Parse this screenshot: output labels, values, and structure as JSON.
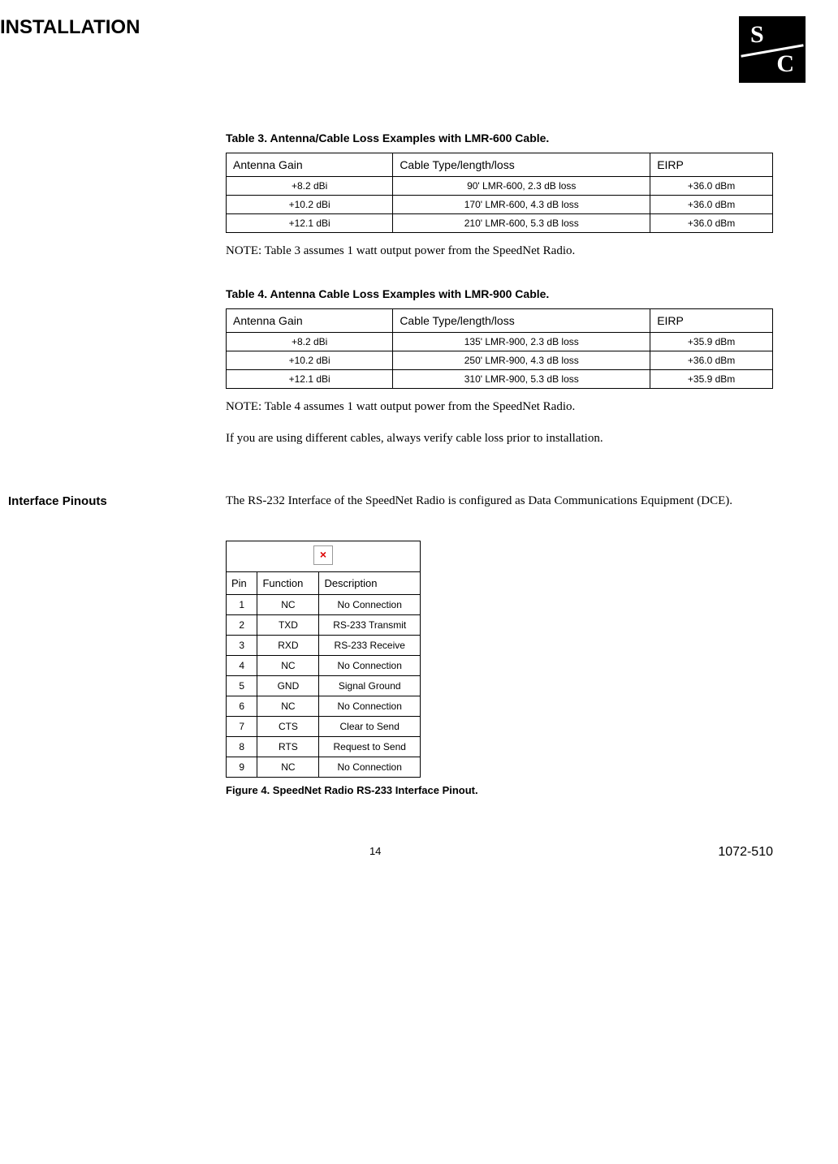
{
  "header": {
    "title": "INSTALLATION"
  },
  "table3": {
    "caption": "Table 3. Antenna/Cable Loss Examples with LMR-600 Cable.",
    "headers": [
      "Antenna Gain",
      "Cable Type/length/loss",
      "EIRP"
    ],
    "rows": [
      [
        "+8.2 dBi",
        "90' LMR-600, 2.3 dB loss",
        "+36.0 dBm"
      ],
      [
        "+10.2 dBi",
        "170' LMR-600, 4.3 dB loss",
        "+36.0 dBm"
      ],
      [
        "+12.1 dBi",
        "210' LMR-600, 5.3 dB loss",
        "+36.0 dBm"
      ]
    ],
    "note": "NOTE: Table 3 assumes 1 watt output power from the SpeedNet Radio."
  },
  "table4": {
    "caption": "Table 4. Antenna Cable Loss Examples with LMR-900 Cable.",
    "headers": [
      "Antenna Gain",
      "Cable Type/length/loss",
      "EIRP"
    ],
    "rows": [
      [
        "+8.2 dBi",
        "135' LMR-900, 2.3 dB loss",
        "+35.9 dBm"
      ],
      [
        "+10.2 dBi",
        "250' LMR-900, 4.3 dB loss",
        "+36.0 dBm"
      ],
      [
        "+12.1 dBi",
        "310' LMR-900, 5.3 dB loss",
        "+35.9 dBm"
      ]
    ],
    "note": "NOTE: Table 4 assumes 1 watt output power from the SpeedNet Radio.",
    "body": "If you are using different cables, always verify cable loss prior to installation."
  },
  "section_pinouts": {
    "label": "Interface Pinouts",
    "intro": "The RS-232 Interface of the SpeedNet Radio is configured as Data Communications Equipment (DCE).",
    "headers": [
      "Pin",
      "Function",
      "Description"
    ],
    "rows": [
      [
        "1",
        "NC",
        "No Connection"
      ],
      [
        "2",
        "TXD",
        "RS-233 Transmit"
      ],
      [
        "3",
        "RXD",
        "RS-233 Receive"
      ],
      [
        "4",
        "NC",
        "No Connection"
      ],
      [
        "5",
        "GND",
        "Signal Ground"
      ],
      [
        "6",
        "NC",
        "No Connection"
      ],
      [
        "7",
        "CTS",
        "Clear to Send"
      ],
      [
        "8",
        "RTS",
        "Request to Send"
      ],
      [
        "9",
        "NC",
        "No Connection"
      ]
    ],
    "figure_caption": "Figure 4. SpeedNet Radio RS-233 Interface Pinout."
  },
  "footer": {
    "page": "14",
    "doc": "1072-510"
  }
}
